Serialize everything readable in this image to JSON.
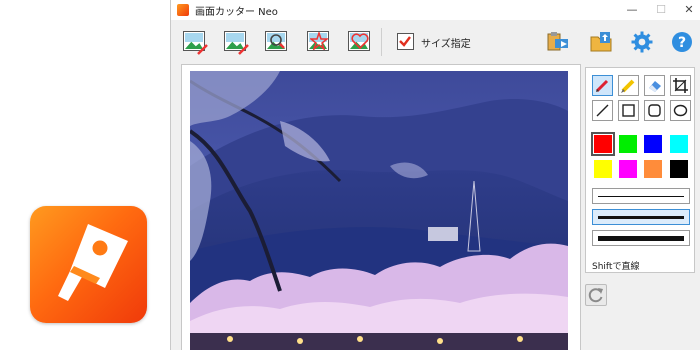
{
  "window": {
    "title": "画面カッター Neo",
    "controls": {
      "minimize": "—",
      "maximize": "☐",
      "close": "✕"
    }
  },
  "toolbar": {
    "buttons": [
      {
        "name": "capture-fullscreen-icon"
      },
      {
        "name": "capture-window-icon"
      },
      {
        "name": "capture-magnify-icon"
      },
      {
        "name": "capture-star-icon"
      },
      {
        "name": "capture-heart-icon"
      }
    ],
    "size_checkbox_label": "サイズ指定",
    "size_checkbox_checked": true,
    "right_icons": [
      "clipboard-export-icon",
      "folder-save-icon",
      "gear-icon",
      "help-icon"
    ]
  },
  "side_panel": {
    "tools": [
      "pen-icon",
      "highlighter-icon",
      "eraser-icon",
      "crop-icon",
      "line-icon",
      "rectangle-icon",
      "rounded-rectangle-icon",
      "ellipse-icon"
    ],
    "selected_tool": "pen-icon",
    "colors": [
      "#ff0000",
      "#00ee00",
      "#0000ff",
      "#00ffff",
      "#ffff00",
      "#ff00ff",
      "#ff8c3a",
      "#000000"
    ],
    "selected_color": "#ff0000",
    "line_widths": [
      "thin",
      "medium",
      "thick"
    ],
    "selected_line_width": "medium",
    "shift_label": "Shiftで直線"
  },
  "colors": {
    "accent": "#ff6a10",
    "selection": "#3c8fd6"
  }
}
